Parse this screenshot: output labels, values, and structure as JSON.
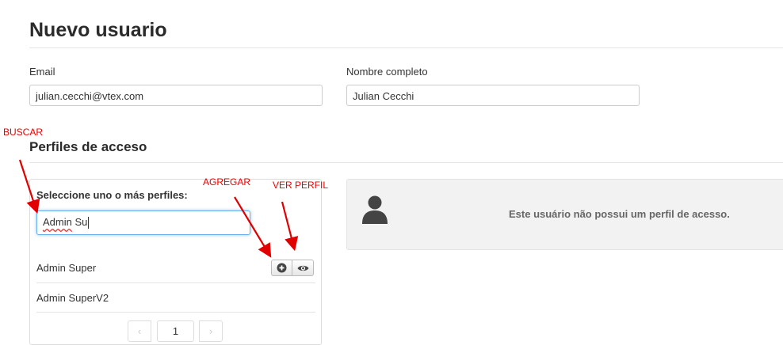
{
  "page": {
    "title": "Nuevo usuario"
  },
  "form": {
    "email": {
      "label": "Email",
      "value": "julian.cecchi@vtex.com"
    },
    "full_name": {
      "label": "Nombre completo",
      "value": "Julian Cecchi"
    }
  },
  "access": {
    "section_title": "Perfiles de acceso",
    "prompt": "Seleccione uno o más perfiles:",
    "search": {
      "value_word1": "Admin",
      "value_word2": " Su"
    },
    "results": [
      {
        "label": "Admin Super"
      },
      {
        "label": "Admin SuperV2"
      }
    ],
    "pagination": {
      "prev": "‹",
      "current": "1",
      "next": "›"
    },
    "empty_message": "Este usuário não possui um perfil de acesso."
  },
  "annotations": {
    "buscar": "BUSCAR",
    "agregar": "AGREGAR",
    "ver_perfil": "VER PERFIL",
    "color": "#e00000"
  },
  "icons": {
    "add": "plus-circle-icon",
    "view": "eye-icon",
    "user": "user-silhouette-icon"
  }
}
